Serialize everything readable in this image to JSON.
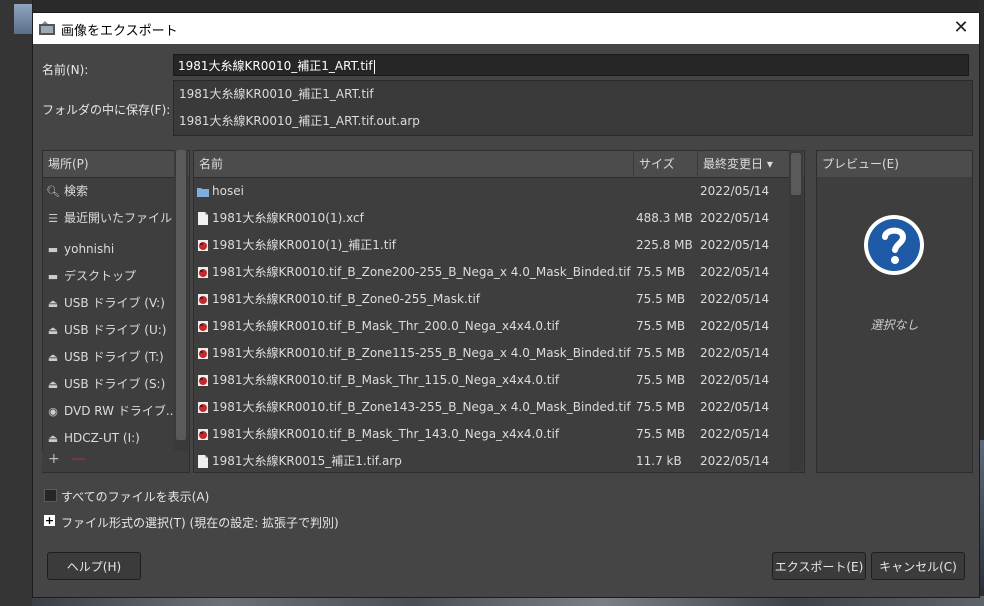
{
  "dialog": {
    "title": "画像をエクスポート",
    "close_glyph": "✕"
  },
  "name_field": {
    "label": "名前(N):",
    "value": "1981大糸線KR0010_補正1_ART.tif"
  },
  "folder": {
    "label": "フォルダの中に保存(F):"
  },
  "autocomplete": [
    "1981大糸線KR0010_補正1_ART.tif",
    "1981大糸線KR0010_補正1_ART.tif.out.arp"
  ],
  "places": {
    "header": "場所(P)",
    "items": [
      {
        "label": "検索",
        "icon": "search-icon"
      },
      {
        "label": "最近開いたファイル",
        "icon": "recent-icon"
      },
      {
        "label": "yohnishi",
        "icon": "folder-icon"
      },
      {
        "label": "デスクトップ",
        "icon": "folder-icon"
      },
      {
        "label": "USB ドライブ (V:)",
        "icon": "drive-icon"
      },
      {
        "label": "USB ドライブ (U:)",
        "icon": "drive-icon"
      },
      {
        "label": "USB ドライブ (T:)",
        "icon": "drive-icon"
      },
      {
        "label": "USB ドライブ (S:)",
        "icon": "drive-icon"
      },
      {
        "label": "DVD RW ドライブ...",
        "icon": "optical-drive-icon"
      },
      {
        "label": "HDCZ-UT (I:)",
        "icon": "drive-icon"
      }
    ],
    "add_glyph": "+",
    "remove_glyph": "—"
  },
  "files": {
    "headers": {
      "name": "名前",
      "size": "サイズ",
      "modified": "最終変更日"
    },
    "rows": [
      {
        "name": "hosei",
        "size": "",
        "date": "2022/05/14",
        "icon": "folder-icon"
      },
      {
        "name": "1981大糸線KR0010(1).xcf",
        "size": "488.3 MB",
        "date": "2022/05/14",
        "icon": "document-icon"
      },
      {
        "name": "1981大糸線KR0010(1)_補正1.tif",
        "size": "225.8 MB",
        "date": "2022/05/14",
        "icon": "image-file-icon"
      },
      {
        "name": "1981大糸線KR0010.tif_B_Zone200-255_B_Nega_x 4.0_Mask_Binded.tif",
        "size": "75.5 MB",
        "date": "2022/05/14",
        "icon": "image-file-icon"
      },
      {
        "name": "1981大糸線KR0010.tif_B_Zone0-255_Mask.tif",
        "size": "75.5 MB",
        "date": "2022/05/14",
        "icon": "image-file-icon"
      },
      {
        "name": "1981大糸線KR0010.tif_B_Mask_Thr_200.0_Nega_x4x4.0.tif",
        "size": "75.5 MB",
        "date": "2022/05/14",
        "icon": "image-file-icon"
      },
      {
        "name": "1981大糸線KR0010.tif_B_Zone115-255_B_Nega_x 4.0_Mask_Binded.tif",
        "size": "75.5 MB",
        "date": "2022/05/14",
        "icon": "image-file-icon"
      },
      {
        "name": "1981大糸線KR0010.tif_B_Mask_Thr_115.0_Nega_x4x4.0.tif",
        "size": "75.5 MB",
        "date": "2022/05/14",
        "icon": "image-file-icon"
      },
      {
        "name": "1981大糸線KR0010.tif_B_Zone143-255_B_Nega_x 4.0_Mask_Binded.tif",
        "size": "75.5 MB",
        "date": "2022/05/14",
        "icon": "image-file-icon"
      },
      {
        "name": "1981大糸線KR0010.tif_B_Mask_Thr_143.0_Nega_x4x4.0.tif",
        "size": "75.5 MB",
        "date": "2022/05/14",
        "icon": "image-file-icon"
      },
      {
        "name": "1981大糸線KR0015_補正1.tif.arp",
        "size": "11.7 kB",
        "date": "2022/05/14",
        "icon": "document-icon"
      }
    ]
  },
  "preview": {
    "header": "プレビュー(E)",
    "no_selection": "選択なし"
  },
  "options": {
    "show_all": "すべてのファイルを表示(A)",
    "file_type": "ファイル形式の選択(T) (現在の設定: 拡張子で判別)"
  },
  "buttons": {
    "help": "ヘルプ(H)",
    "export": "エクスポート(E)",
    "cancel": "キャンセル(C)"
  },
  "colors": {
    "dialog_bg": "#454545",
    "folder_icon": "#7eaee0",
    "image_icon": "#c8282c",
    "question_icon": "#1e5aa6"
  }
}
